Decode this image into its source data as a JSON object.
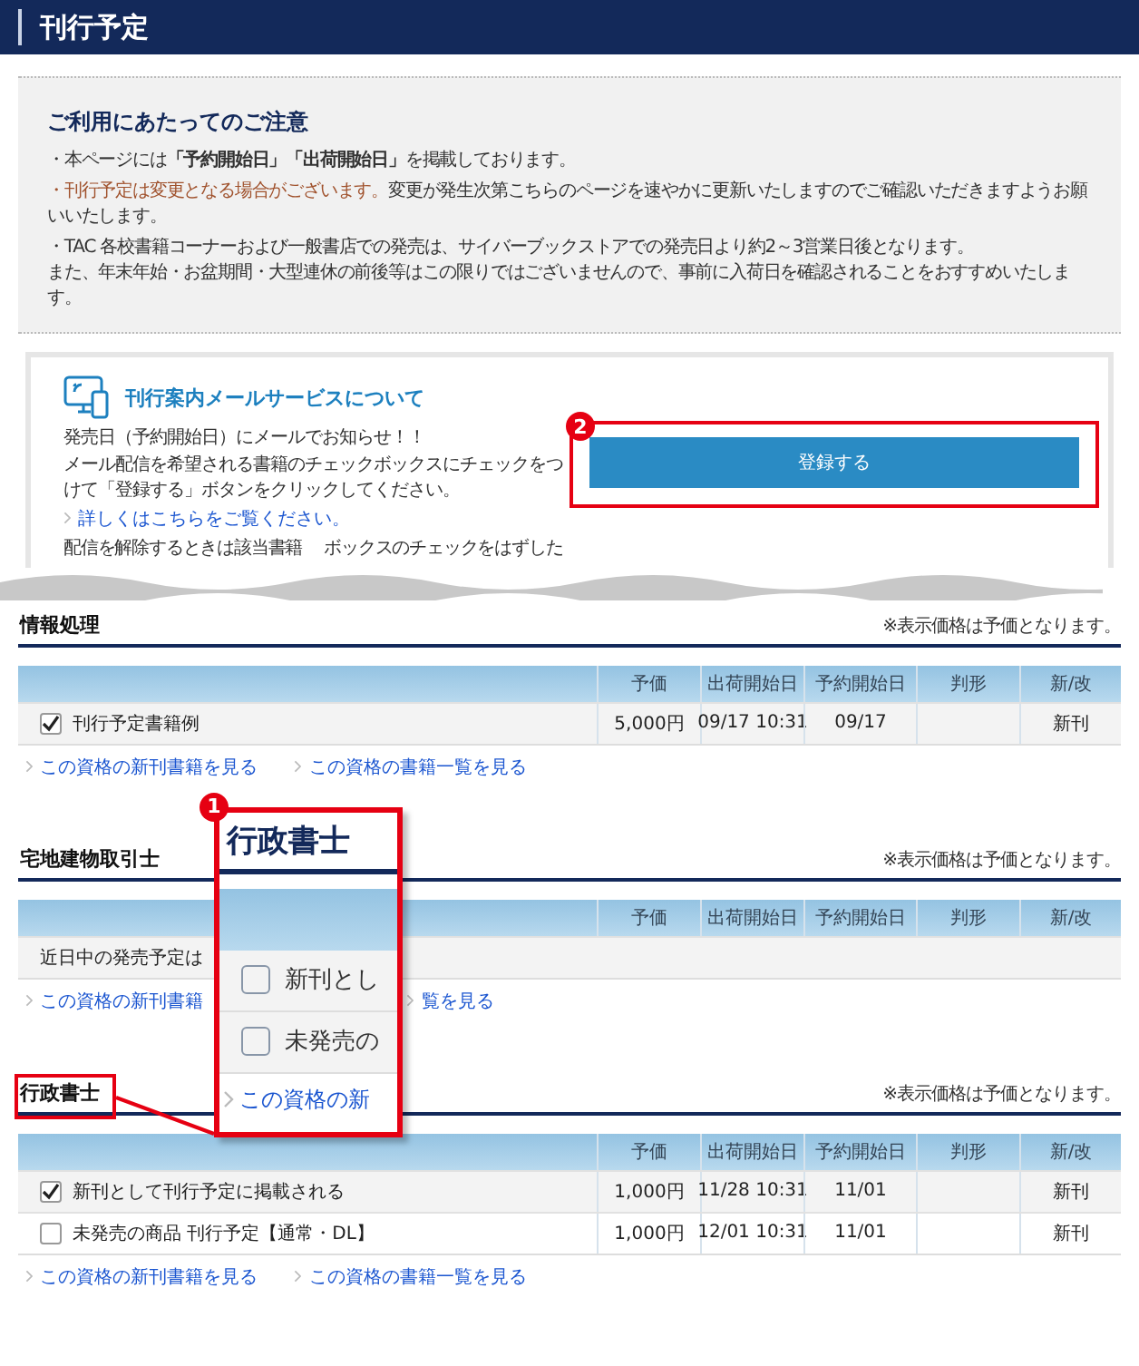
{
  "header": {
    "title": "刊行予定"
  },
  "notice": {
    "title": "ご利用にあたってのご注意",
    "items": [
      {
        "text": "・本ページには**「予約開始日」「出荷開始日」**を掲載しております。"
      },
      {
        "warning": "・刊行予定は変更となる場合がございます。",
        "text": "変更が発生次第こちらのページを速やかに更新いたしますのでご確認いただきますようお願いいたします。"
      },
      {
        "text": "・TAC 各校書籍コーナーおよび一般書店での発売は、サイバーブックストアでの発売日より約2～3営業日後となります。",
        "continuation": "また、年末年始・お盆期間・大型連休の前後等はこの限りではございませんので、事前に入荷日を確認されることをおすすめいたします。"
      }
    ]
  },
  "mail": {
    "title": "刊行案内メールサービスについて",
    "lines": [
      "発売日（予約開始日）にメールでお知らせ！！",
      "メール配信を希望される書籍のチェックボックスにチェックをつけて「登録する」ボタンをクリックしてください。"
    ],
    "link": "詳しくはこちらをご覧ください。",
    "cut_fragments": [
      "配信を解除するときは該当書籍",
      "ボックスのチェックをはずした"
    ],
    "button": "登録する",
    "badge": "2"
  },
  "sections": [
    {
      "title": "情報処理",
      "note": "※表示価格は予価となります。",
      "columns": [
        "予価",
        "出荷開始日",
        "予約開始日",
        "判形",
        "新/改"
      ],
      "highlighted": false,
      "callout_over": false,
      "rows": [
        {
          "kind": "book",
          "checked": true,
          "title": "刊行予定書籍例",
          "price": "5,000円",
          "ship": "09/17 10:31",
          "reserve": "09/17",
          "type": "新刊"
        }
      ],
      "links": [
        "この資格の新刊書籍を見る",
        "この資格の書籍一覧を見る"
      ]
    },
    {
      "title": "宅地建物取引士",
      "note": "※表示価格は予価となります。",
      "columns": [
        "予価",
        "出荷開始日",
        "予約開始日",
        "判形",
        "新/改"
      ],
      "highlighted": false,
      "callout_over": true,
      "rows": [
        {
          "kind": "message",
          "text": "近日中の発売予定は"
        }
      ],
      "links": [
        "この資格の新刊書籍",
        "覧を見る"
      ]
    },
    {
      "title": "行政書士",
      "note": "※表示価格は予価となります。",
      "columns": [
        "予価",
        "出荷開始日",
        "予約開始日",
        "判形",
        "新/改"
      ],
      "highlighted": true,
      "callout_over": false,
      "rows": [
        {
          "kind": "book",
          "checked": true,
          "title": "新刊として刊行予定に掲載される",
          "price": "1,000円",
          "ship": "11/28 10:31",
          "reserve": "11/01",
          "type": "新刊"
        },
        {
          "kind": "book",
          "checked": false,
          "title": "未発売の商品 刊行予定【通常・DL】",
          "price": "1,000円",
          "ship": "12/01 10:31",
          "reserve": "11/01",
          "type": "新刊"
        }
      ],
      "links": [
        "この資格の新刊書籍を見る",
        "この資格の書籍一覧を見る"
      ]
    }
  ],
  "callout": {
    "badge": "1",
    "title": "行政書士",
    "rows": [
      {
        "checked": false,
        "text": "新刊とし"
      },
      {
        "checked": false,
        "text": "未発売の"
      }
    ],
    "link": "この資格の新"
  }
}
